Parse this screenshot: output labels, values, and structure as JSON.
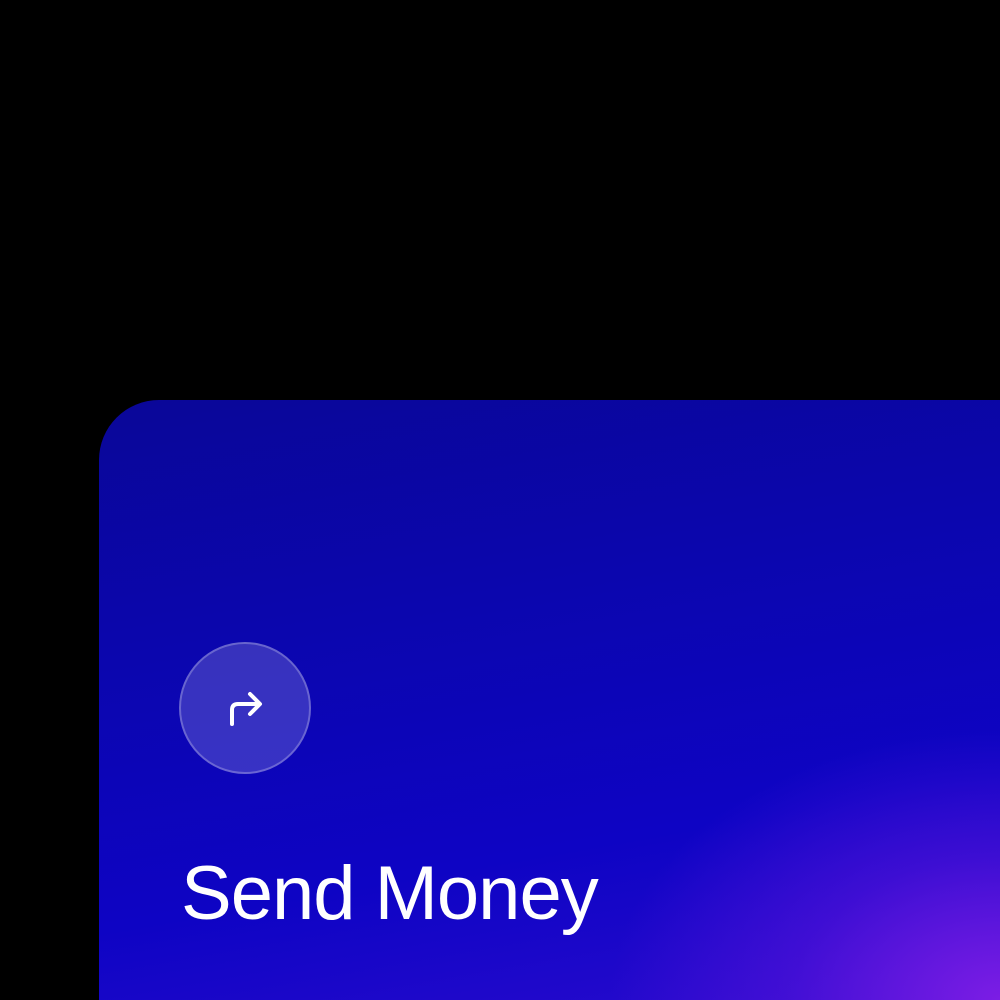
{
  "card": {
    "title": "Send Money",
    "icon": "arrow-turn-up-right-icon",
    "colors": {
      "gradient_start": "#0a0798",
      "gradient_mid": "#0e04c4",
      "gradient_glow": "#801ee6",
      "text": "#ffffff"
    }
  }
}
